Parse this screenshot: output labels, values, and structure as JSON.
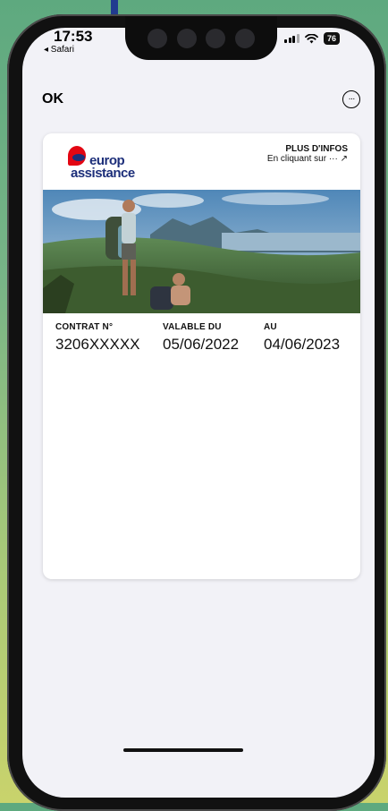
{
  "status_bar": {
    "time": "17:53",
    "back_app": "◂ Safari",
    "battery": "76"
  },
  "nav": {
    "ok_label": "OK",
    "more_label": "···"
  },
  "card": {
    "brand_line1": "europ",
    "brand_line2": "assistance",
    "info_title": "PLUS D'INFOS",
    "info_sub": "En cliquant sur ··· ↗",
    "fields": [
      {
        "label": "CONTRAT N°",
        "value": "3206XXXXX"
      },
      {
        "label": "VALABLE DU",
        "value": "05/06/2022"
      },
      {
        "label": "AU",
        "value": "04/06/2023"
      }
    ]
  },
  "colors": {
    "brand_blue": "#1d2f7a",
    "brand_red": "#e30613",
    "background": "#f2f2f7"
  }
}
